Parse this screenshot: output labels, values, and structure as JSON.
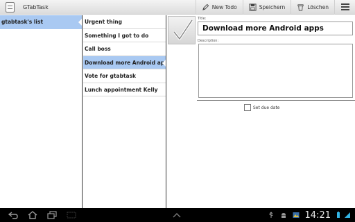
{
  "app": {
    "title": "GTabTask"
  },
  "actionbar": {
    "new_todo": "New Todo",
    "save": "Speichern",
    "delete": "Löschen"
  },
  "lists": [
    {
      "label": "gtabtask's list",
      "selected": true
    }
  ],
  "tasks": [
    {
      "label": "Urgent thing",
      "selected": false
    },
    {
      "label": "Something I got to do",
      "selected": false
    },
    {
      "label": "Call boss",
      "selected": false
    },
    {
      "label": "Download more Android apps",
      "selected": true
    },
    {
      "label": "Vote for gtabtask",
      "selected": false
    },
    {
      "label": "Lunch appointment Kelly",
      "selected": false
    }
  ],
  "detail": {
    "title_label": "Title:",
    "title_value": "Download more Android apps",
    "description_label": "Description:",
    "description_value": "",
    "due_date_label": "Set due date",
    "due_date_checked": false
  },
  "statusbar": {
    "time": "14:21"
  },
  "colors": {
    "selected": "#a9c9f2",
    "system_bar": "#000000"
  },
  "icons": [
    "app-icon",
    "pencil-icon",
    "save-icon",
    "trash-icon",
    "overflow-menu-icon",
    "back-icon",
    "home-icon",
    "recent-apps-icon",
    "screenshot-icon",
    "up-chevron-icon",
    "usb-icon",
    "android-icon",
    "gallery-icon",
    "battery-icon",
    "wifi-icon",
    "checkmark-icon"
  ]
}
